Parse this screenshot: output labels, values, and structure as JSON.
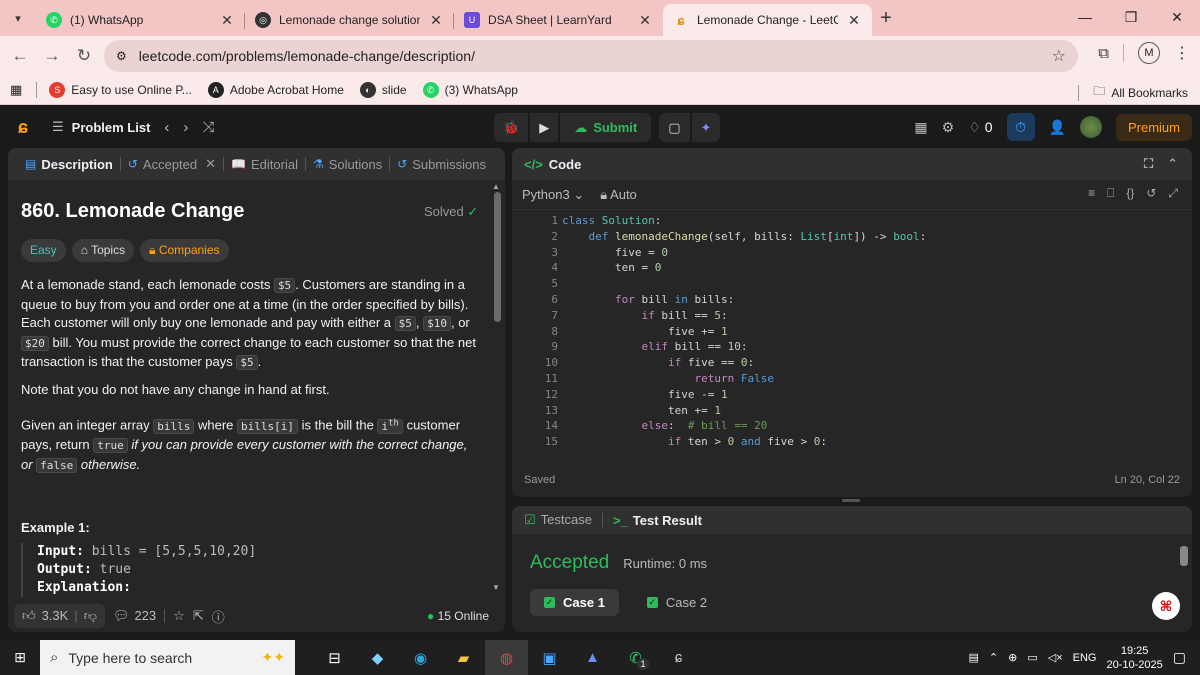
{
  "browser": {
    "tabs": [
      {
        "title": "(1) WhatsApp",
        "active": false
      },
      {
        "title": "Lemonade change solution",
        "active": false
      },
      {
        "title": "DSA Sheet | LearnYard",
        "active": false
      },
      {
        "title": "Lemonade Change - LeetCode",
        "active": true
      }
    ],
    "url": "leetcode.com/problems/lemonade-change/description/",
    "profile_initial": "M",
    "bookmarks": [
      {
        "label": "Easy to use Online P..."
      },
      {
        "label": "Adobe Acrobat Home"
      },
      {
        "label": "slide"
      },
      {
        "label": "(3) WhatsApp"
      }
    ],
    "all_bookmarks": "All Bookmarks"
  },
  "header": {
    "problem_list": "Problem List",
    "submit": "Submit",
    "fire_count": "0",
    "premium": "Premium"
  },
  "desc_panel": {
    "tabs": [
      "Description",
      "Accepted",
      "Editorial",
      "Solutions",
      "Submissions"
    ],
    "title": "860. Lemonade Change",
    "solved": "Solved",
    "chips": [
      "Easy",
      "Topics",
      "Companies"
    ],
    "p1_a": "At a lemonade stand, each lemonade costs ",
    "c_5": "$5",
    "p1_b": ". Customers are standing in a queue to buy from you and order one at a time (in the order specified by bills). Each customer will only buy one lemonade and pay with either a ",
    "c_10": "$10",
    "c_20": "$20",
    "p1_c": " bill. You must provide the correct change to each customer so that the net transaction is that the customer pays ",
    "p2": "Note that you do not have any change in hand at first.",
    "p3_a": "Given an integer array ",
    "c_bills": "bills",
    "p3_b": " where ",
    "c_billsi": "bills[i]",
    "p3_c": " is the bill the ",
    "c_ith": "i",
    "c_th": "th",
    "p3_d": " customer pays, return ",
    "c_true": "true",
    "p3_e": " if you can provide every customer with the correct change, or ",
    "c_false": "false",
    "p3_f": "otherwise.",
    "example_title": "Example 1:",
    "ex_input_label": "Input:",
    "ex_input": " bills = [5,5,5,10,20]",
    "ex_output_label": "Output:",
    "ex_output": " true",
    "ex_expl_label": "Explanation:",
    "likes": "3.3K",
    "comments": "223",
    "online": "15 Online"
  },
  "code_panel": {
    "title": "Code",
    "language": "Python3",
    "mode": "Auto",
    "status": "Saved",
    "cursor": "Ln 20, Col 22",
    "line_numbers": [
      "1",
      "2",
      "3",
      "4",
      "5",
      "6",
      "7",
      "8",
      "9",
      "10",
      "11",
      "12",
      "13",
      "14",
      "15"
    ]
  },
  "result_panel": {
    "tabs": [
      "Testcase",
      "Test Result"
    ],
    "verdict": "Accepted",
    "runtime": "Runtime: 0 ms",
    "cases": [
      "Case 1",
      "Case 2"
    ]
  },
  "taskbar": {
    "search_placeholder": "Type here to search",
    "language": "ENG",
    "time": "19:25",
    "date": "20-10-2025",
    "whatsapp_badge": "1"
  },
  "colors": {
    "accent": "#ffa116",
    "success": "#2cbb5d",
    "easy": "#46c6c2"
  }
}
